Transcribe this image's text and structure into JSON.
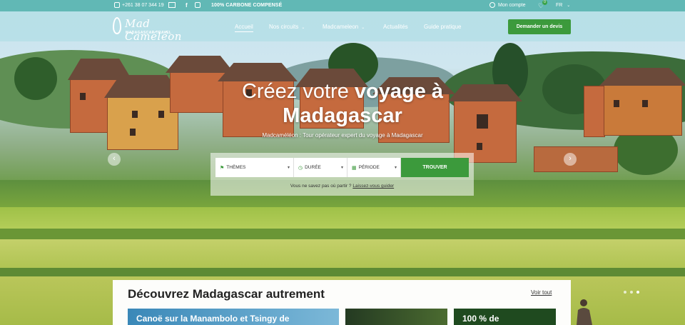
{
  "topbar": {
    "phone": "+261 38 07 344 19",
    "icons": [
      "phone-icon",
      "mail-icon",
      "facebook-icon",
      "instagram-icon"
    ],
    "carbon": "100% CARBONE COMPENSÉ",
    "account": "Mon compte",
    "favorites_count": "0",
    "language": "FR"
  },
  "logo": {
    "brand": "Mad Caméléon",
    "tagline": "MADAGASCAR TRAVEL"
  },
  "nav": {
    "items": [
      {
        "label": "Accueil",
        "active": true
      },
      {
        "label": "Nos circuits",
        "dropdown": true
      },
      {
        "label": "Madcameleon",
        "dropdown": true
      },
      {
        "label": "Actualités"
      },
      {
        "label": "Guide pratique"
      }
    ],
    "cta": "Demander un devis"
  },
  "hero": {
    "headline_light": "Créez votre",
    "headline_bold_1": "voyage à",
    "headline_bold_2": "Madagascar",
    "subheading": "Madcaméléon : Tour opérateur expert du voyage à Madagascar"
  },
  "search": {
    "themes": "THÈMES",
    "duration": "DURÉE",
    "period": "PÉRIODE",
    "button": "TROUVER",
    "helper_text": "Vous ne savez pas où partir ?",
    "helper_link": "Laissez-vous guider"
  },
  "discover": {
    "title": "Découvrez Madagascar autrement",
    "see_all": "Voir tout",
    "tiles": [
      {
        "title": "Canoë sur la Manambolo et Tsingy de"
      },
      {
        "title": ""
      },
      {
        "title": "100 % de"
      }
    ]
  },
  "colors": {
    "accent_green": "#3c9a3c",
    "topbar": "#58b4b0"
  }
}
